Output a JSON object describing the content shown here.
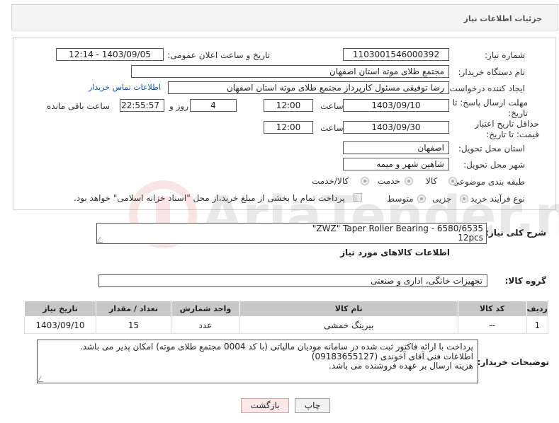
{
  "header": {
    "title": "جزئیات اطلاعات نیاز"
  },
  "form": {
    "need_number_label": "شماره نیاز:",
    "need_number": "1103001546000392",
    "announce_label": "تاریخ و ساعت اعلان عمومی:",
    "announce_value": "1403/09/05 - 12:14",
    "buyer_org_label": "نام دستگاه خریدار:",
    "buyer_org": "مجتمع طلای موته استان اصفهان",
    "creator_label": "ایجاد کننده درخواست:",
    "creator": "رضا توفیقی مسئول کارپرداز مجتمع طلای موته استان اصفهان",
    "contact_link": "اطلاعات تماس خریدار",
    "deadline_label": "مهلت ارسال پاسخ: تا تاریخ:",
    "deadline_date": "1403/09/10",
    "time_label": "ساعت",
    "deadline_time": "12:00",
    "days_value": "4",
    "days_label": "روز و",
    "remaining_time": "22:55:57",
    "remaining_label": "ساعت باقی مانده",
    "price_validity_label": "حداقل تاریخ اعتبار قیمت: تا تاریخ:",
    "price_validity_date": "1403/09/30",
    "price_validity_time": "12:00",
    "province_label": "استان محل تحویل:",
    "province": "اصفهان",
    "city_label": "شهر محل تحویل:",
    "city": "شاهین شهر و میمه",
    "category_label": "طبقه بندی موضوعی:",
    "category_options": [
      "کالا",
      "خدمت",
      "کالا/خدمت"
    ],
    "process_label": "نوع فرآیند خرید :",
    "process_options": [
      "جزیی",
      "متوسط"
    ],
    "payment_note": "پرداخت تمام یا بخشی از مبلغ خرید،از محل \"اسناد خزانه اسلامی\" خواهد بود."
  },
  "description": {
    "label": "شرح کلی نیاز:",
    "line1": "\"ZWZ\" Taper Roller Bearing - 6580/6535",
    "line2": "12pcs"
  },
  "goods": {
    "section_title": "اطلاعات کالاهای مورد نیاز",
    "group_label": "گروه کالا:",
    "group_value": "تجهیزات خانگی، اداری و صنعتی",
    "columns": [
      "ردیف",
      "کد کالا",
      "نام کالا",
      "واحد شمارش",
      "تعداد / مقدار",
      "تاریخ نیاز"
    ],
    "rows": [
      {
        "row": "1",
        "code": "--",
        "name": "بیرینگ خمشی",
        "unit": "عدد",
        "qty": "15",
        "date": "1403/09/10"
      }
    ]
  },
  "buyer_notes": {
    "label": "توضیحات خریدار:",
    "lines": [
      "پرداخت با ارائه فاکتور ثبت شده در سامانه مودیان مالیاتی (با کد 0004 مجتمع طلای موته) امکان پذیر می باشد.",
      "اطلاعات فنی آقای آخوندی (09183655127)",
      "هزینه ارسال بر عهده فروشنده می باشد."
    ]
  },
  "buttons": {
    "print": "چاپ",
    "back": "بازگشت"
  },
  "watermark_text": "AriaTender.neT",
  "colors": {
    "link": "#1155aa",
    "table_header": "#c8c8c8",
    "back_button": "#fde8e8"
  }
}
